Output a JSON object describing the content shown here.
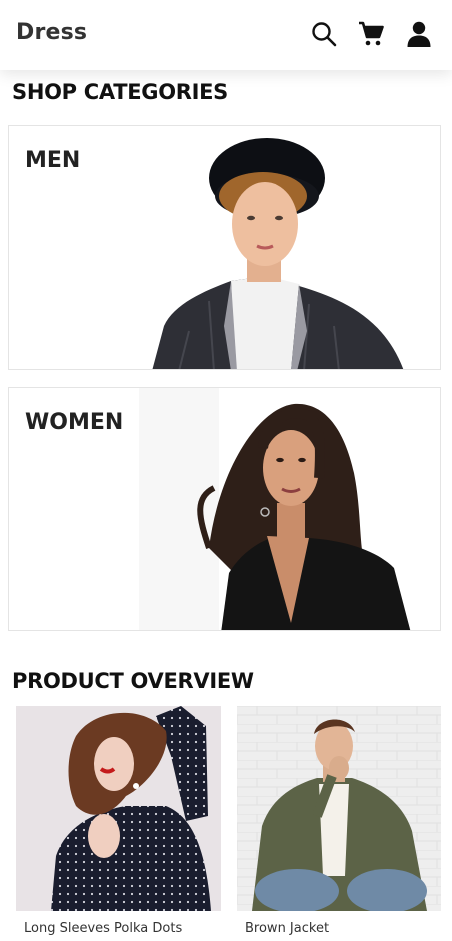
{
  "header": {
    "brand": "Dress",
    "icons": [
      "search-icon",
      "cart-icon",
      "user-icon"
    ]
  },
  "categories": {
    "title": "SHOP CATEGORIES",
    "items": [
      {
        "label": "MEN"
      },
      {
        "label": "WOMEN"
      }
    ]
  },
  "products": {
    "title": "PRODUCT OVERVIEW",
    "items": [
      {
        "name": "Long Sleeves Polka Dots"
      },
      {
        "name": "Brown Jacket"
      }
    ]
  },
  "colors": {
    "brand_text": "#333333",
    "title_text": "#111111",
    "card_border": "#e4e4e4"
  }
}
